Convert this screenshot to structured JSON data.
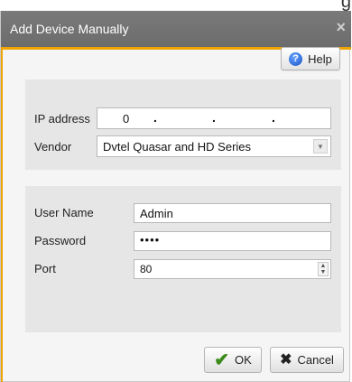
{
  "window": {
    "title": "Add Device Manually",
    "close_glyph": "×",
    "corner_glyph": "g"
  },
  "toolbar": {
    "help_label": "Help",
    "help_icon": "help-icon"
  },
  "connection": {
    "ip_label": "IP address",
    "ip_octets": [
      "0",
      "",
      "",
      ""
    ],
    "vendor_label": "Vendor",
    "vendor_value": "Dvtel Quasar and HD Series"
  },
  "credentials": {
    "username_label": "User Name",
    "username_value": "Admin",
    "password_label": "Password",
    "password_value": "••••",
    "port_label": "Port",
    "port_value": "80"
  },
  "footer": {
    "ok_label": "OK",
    "cancel_label": "Cancel"
  },
  "colors": {
    "accent": "#f0a400",
    "titlebar": "#747474",
    "panel": "#e6e6e6"
  }
}
